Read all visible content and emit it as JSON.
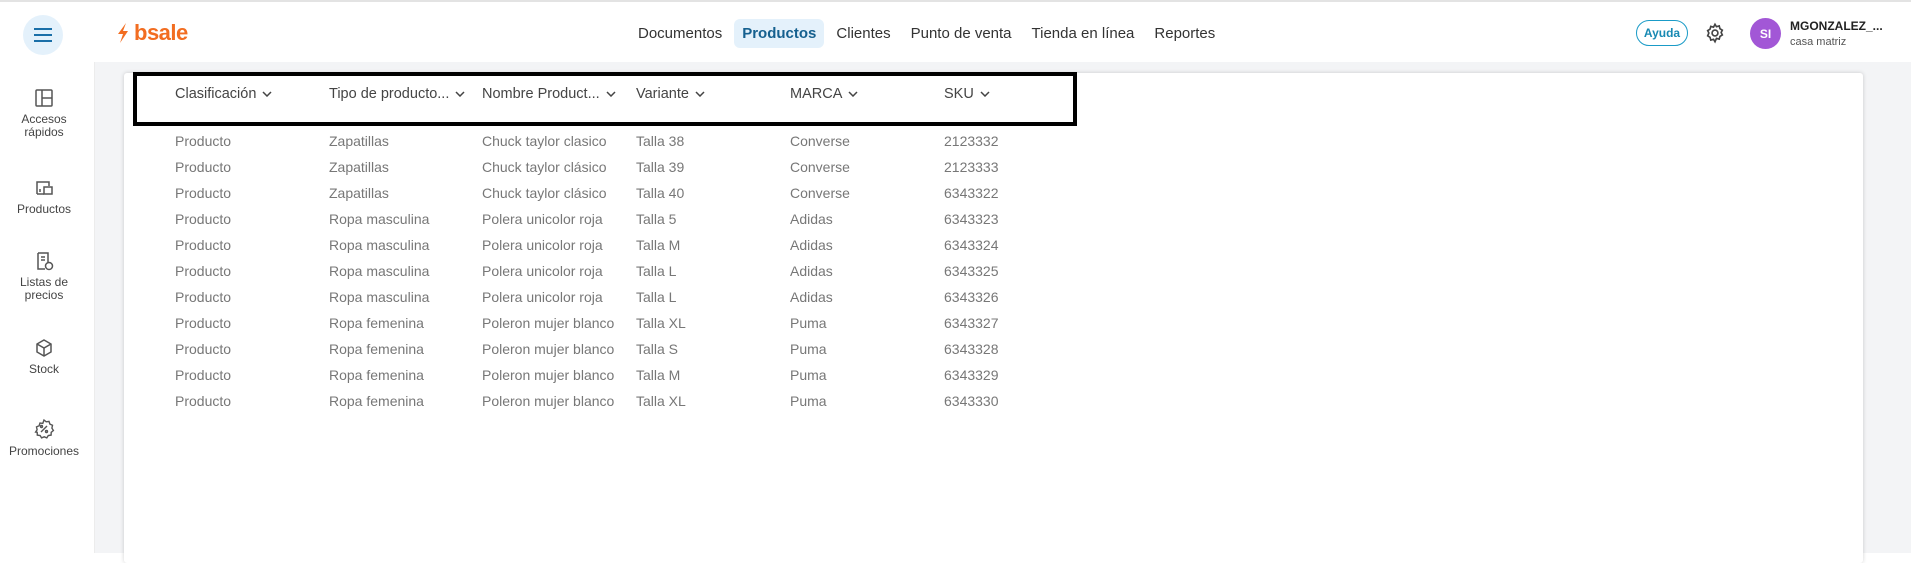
{
  "header": {
    "logo_text": "bsale",
    "nav": [
      "Documentos",
      "Productos",
      "Clientes",
      "Punto de venta",
      "Tienda en línea",
      "Reportes"
    ],
    "active_nav": "Productos",
    "help_label": "Ayuda",
    "user": {
      "initials": "SI",
      "name": "MGONZALEZ_...",
      "branch": "casa matriz"
    }
  },
  "sidebar": {
    "items": [
      {
        "label": "Accesos rápidos",
        "icon": "layout-icon"
      },
      {
        "label": "Productos",
        "icon": "products-icon"
      },
      {
        "label": "Listas de precios",
        "icon": "price-list-icon"
      },
      {
        "label": "Stock",
        "icon": "box-icon"
      },
      {
        "label": "Promociones",
        "icon": "discount-icon"
      }
    ]
  },
  "table": {
    "headers": [
      "Clasificación",
      "Tipo de producto...",
      "Nombre Product...",
      "Variante",
      "MARCA",
      "SKU"
    ],
    "rows": [
      [
        "Producto",
        "Zapatillas",
        "Chuck taylor clasico",
        "Talla 38",
        "Converse",
        "2123332"
      ],
      [
        "Producto",
        "Zapatillas",
        "Chuck taylor clásico",
        "Talla 39",
        "Converse",
        "2123333"
      ],
      [
        "Producto",
        "Zapatillas",
        "Chuck taylor clásico",
        "Talla 40",
        "Converse",
        "6343322"
      ],
      [
        "Producto",
        "Ropa masculina",
        "Polera unicolor roja",
        "Talla 5",
        "Adidas",
        "6343323"
      ],
      [
        "Producto",
        "Ropa masculina",
        "Polera unicolor roja",
        "Talla M",
        "Adidas",
        "6343324"
      ],
      [
        "Producto",
        "Ropa masculina",
        "Polera unicolor roja",
        "Talla L",
        "Adidas",
        "6343325"
      ],
      [
        "Producto",
        "Ropa masculina",
        "Polera unicolor roja",
        "Talla L",
        "Adidas",
        "6343326"
      ],
      [
        "Producto",
        "Ropa femenina",
        "Poleron mujer blanco",
        "Talla XL",
        "Puma",
        "6343327"
      ],
      [
        "Producto",
        "Ropa femenina",
        "Poleron mujer blanco",
        "Talla S",
        "Puma",
        "6343328"
      ],
      [
        "Producto",
        "Ropa femenina",
        "Poleron mujer blanco",
        "Talla M",
        "Puma",
        "6343329"
      ],
      [
        "Producto",
        "Ropa femenina",
        "Poleron mujer blanco",
        "Talla XL",
        "Puma",
        "6343330"
      ]
    ]
  },
  "colors": {
    "brand": "#f26d21",
    "accent": "#1a9bc7",
    "avatar": "#a257d6"
  }
}
